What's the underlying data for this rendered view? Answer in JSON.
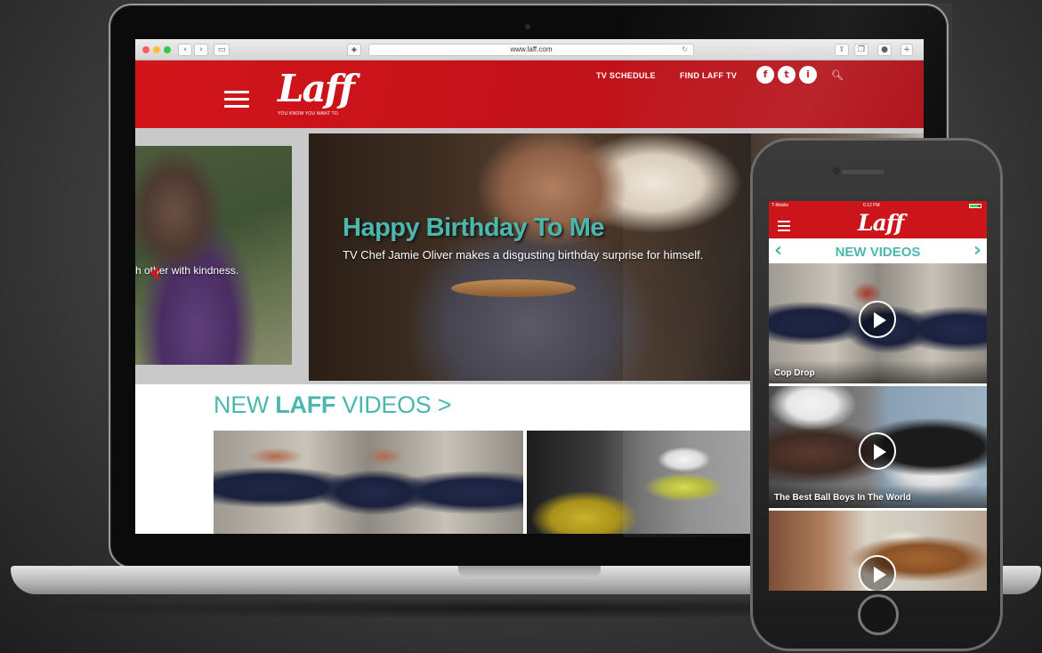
{
  "browser": {
    "url": "www.laff.com"
  },
  "site": {
    "logo": "Laff",
    "tagline": "YOU KNOW YOU WANT TO.",
    "nav": {
      "tv_schedule": "TV SCHEDULE",
      "find_laff_tv": "FIND LAFF TV"
    },
    "social": [
      "f",
      "t",
      "i"
    ]
  },
  "hero": {
    "prev_caption": "h other with kindness.",
    "title": "Happy Birthday To Me",
    "description": "TV Chef Jamie Oliver makes a disgusting birthday surprise for himself."
  },
  "new_videos": {
    "prefix": "NEW ",
    "bold": "LAFF",
    "suffix": " VIDEOS >"
  },
  "phone": {
    "status": {
      "carrier": "T-Mobile",
      "time": "6:12 PM"
    },
    "logo": "Laff",
    "section_title": "NEW VIDEOS",
    "cards": [
      {
        "title": "Cop Drop"
      },
      {
        "title": "The Best Ball Boys In The World"
      },
      {
        "title": ""
      }
    ]
  },
  "colors": {
    "brand_red": "#cc141b",
    "accent_teal": "#4cb8ad"
  }
}
